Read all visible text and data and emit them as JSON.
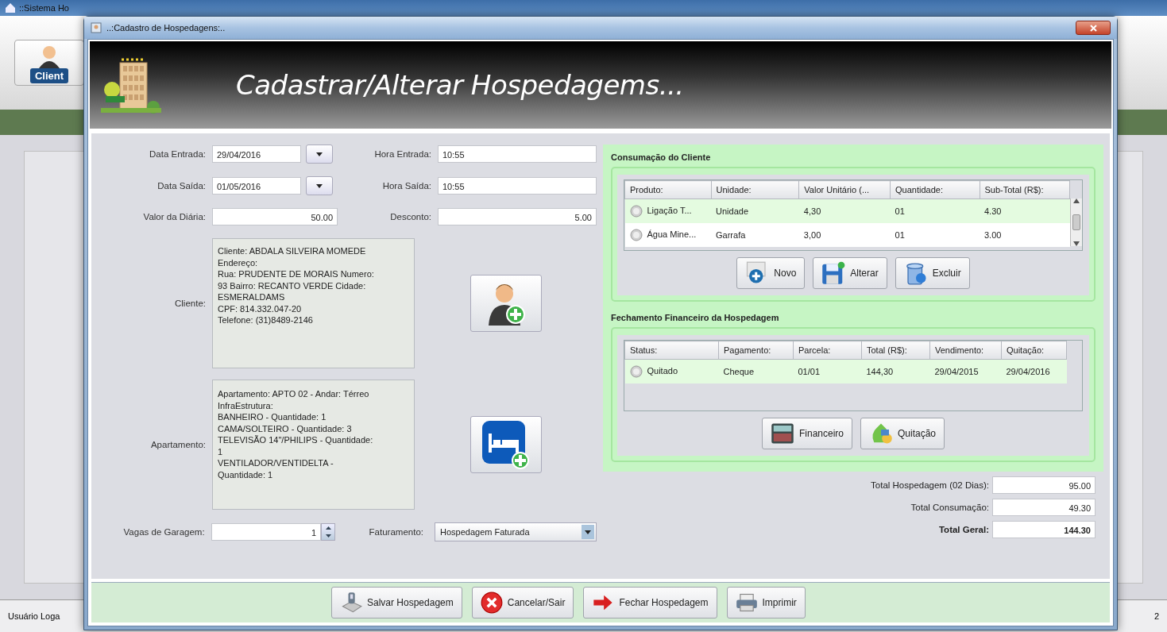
{
  "background_window": {
    "title": "::Sistema Ho",
    "sidebar_button": "Client",
    "status_text": "Usuário Loga",
    "corner_text": "2"
  },
  "dialog": {
    "title": "..:Cadastro de Hospedagens:..",
    "header_title": "Cadastrar/Alterar Hospedagems..."
  },
  "fields": [
    {
      "label": "Data Entrada:",
      "value": "29/04/2016",
      "kind": "date"
    },
    {
      "label": "Hora Entrada:",
      "value": "10:55",
      "kind": "text"
    },
    {
      "label": "Data Saída:",
      "value": "01/05/2016",
      "kind": "date"
    },
    {
      "label": "Hora Saída:",
      "value": "10:55",
      "kind": "text"
    },
    {
      "label": "Valor da Diária:",
      "value": "50.00",
      "kind": "number"
    },
    {
      "label": "Desconto:",
      "value": "5.00",
      "kind": "number"
    }
  ],
  "client": {
    "label": "Cliente:",
    "text": "Cliente: ABDALA SILVEIRA MOMEDE\nEndereço:\nRua: PRUDENTE DE MORAIS Numero:\n93 Bairro: RECANTO VERDE Cidade:\nESMERALDAMS\nCPF: 814.332.047-20\nTelefone: (31)8489-2146"
  },
  "apartment": {
    "label": "Apartamento:",
    "text": "Apartamento: APTO 02 - Andar: Térreo\nInfraEstrutura:\nBANHEIRO - Quantidade: 1\nCAMA/SOLTEIRO - Quantidade: 3\nTELEVISÃO 14\"/PHILIPS - Quantidade:\n1\nVENTILADOR/VENTIDELTA -\nQuantidade: 1"
  },
  "parking": {
    "label": "Vagas de Garagem:",
    "value": "1"
  },
  "billing": {
    "label": "Faturamento:",
    "value": "Hospedagem Faturada"
  },
  "consumption": {
    "title": "Consumação do Cliente",
    "columns": [
      "Produto:",
      "Unidade:",
      "Valor Unitário (...",
      "Quantidade:",
      "Sub-Total (R$):"
    ],
    "rows": [
      {
        "cells": [
          "Ligação T...",
          "Unidade",
          "4,30",
          "01",
          "4.30"
        ],
        "selected": true
      },
      {
        "cells": [
          "Água Mine...",
          "Garrafa",
          "3,00",
          "01",
          "3.00"
        ],
        "selected": false
      }
    ],
    "buttons": [
      {
        "label": "Novo",
        "kind": "new"
      },
      {
        "label": "Alterar",
        "kind": "edit"
      },
      {
        "label": "Excluir",
        "kind": "delete"
      }
    ]
  },
  "financial": {
    "title": "Fechamento Financeiro da Hospedagem",
    "columns": [
      "Status:",
      "Pagamento:",
      "Parcela:",
      "Total (R$):",
      "Vendimento:",
      "Quitação:"
    ],
    "rows": [
      {
        "cells": [
          "Quitado",
          "Cheque",
          "01/01",
          "144,30",
          "29/04/2015",
          "29/04/2016"
        ],
        "selected": true
      }
    ],
    "buttons": [
      {
        "label": "Financeiro",
        "kind": "finance"
      },
      {
        "label": "Quitação",
        "kind": "payoff"
      }
    ]
  },
  "totals": [
    {
      "label": "Total Hospedagem (02 Dias):",
      "value": "95.00",
      "kind": "normal"
    },
    {
      "label": "Total Consumação:",
      "value": "49.30",
      "kind": "normal"
    },
    {
      "label": "Total Geral:",
      "value": "144.30",
      "kind": "grand"
    }
  ],
  "footer_buttons": [
    {
      "label": "Salvar Hospedagem",
      "kind": "save"
    },
    {
      "label": "Cancelar/Sair",
      "kind": "cancel"
    },
    {
      "label": "Fechar Hospedagem",
      "kind": "close"
    },
    {
      "label": "Imprimir",
      "kind": "print"
    }
  ]
}
